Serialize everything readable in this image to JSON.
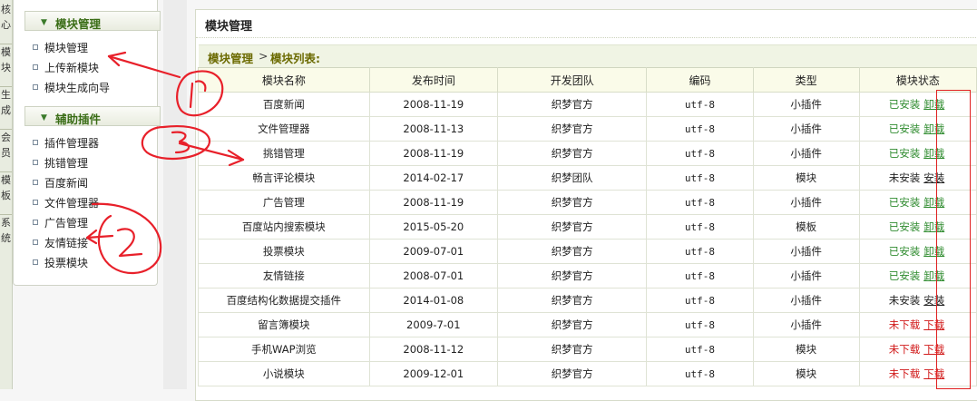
{
  "left_tabs": [
    "核心",
    "模块",
    "生成",
    "会员",
    "模板",
    "系统"
  ],
  "sidebar": {
    "groups": [
      {
        "title": "模块管理",
        "items": [
          "模块管理",
          "上传新模块",
          "模块生成向导"
        ]
      },
      {
        "title": "辅助插件",
        "items": [
          "插件管理器",
          "挑错管理",
          "百度新闻",
          "文件管理器",
          "广告管理",
          "友情链接",
          "投票模块"
        ]
      }
    ]
  },
  "main": {
    "title": "模块管理",
    "breadcrumb": {
      "part1": "模块管理",
      "sep": ">",
      "part2": "模块列表:"
    }
  },
  "table": {
    "headers": [
      "模块名称",
      "发布时间",
      "开发团队",
      "编码",
      "类型",
      "模块状态"
    ],
    "rows": [
      {
        "name": "百度新闻",
        "date": "2008-11-19",
        "team": "织梦官方",
        "enc": "utf-8",
        "type": "小插件",
        "status": "已安装",
        "action": "卸载",
        "color": "#2e8b2e"
      },
      {
        "name": "文件管理器",
        "date": "2008-11-13",
        "team": "织梦官方",
        "enc": "utf-8",
        "type": "小插件",
        "status": "已安装",
        "action": "卸载",
        "color": "#2e8b2e"
      },
      {
        "name": "挑错管理",
        "date": "2008-11-19",
        "team": "织梦官方",
        "enc": "utf-8",
        "type": "小插件",
        "status": "已安装",
        "action": "卸载",
        "color": "#2e8b2e"
      },
      {
        "name": "畅言评论模块",
        "date": "2014-02-17",
        "team": "织梦团队",
        "enc": "utf-8",
        "type": "模块",
        "status": "未安装",
        "action": "安装",
        "color": "#222222"
      },
      {
        "name": "广告管理",
        "date": "2008-11-19",
        "team": "织梦官方",
        "enc": "utf-8",
        "type": "小插件",
        "status": "已安装",
        "action": "卸载",
        "color": "#2e8b2e"
      },
      {
        "name": "百度站内搜索模块",
        "date": "2015-05-20",
        "team": "织梦官方",
        "enc": "utf-8",
        "type": "模板",
        "status": "已安装",
        "action": "卸载",
        "color": "#2e8b2e"
      },
      {
        "name": "投票模块",
        "date": "2009-07-01",
        "team": "织梦官方",
        "enc": "utf-8",
        "type": "小插件",
        "status": "已安装",
        "action": "卸载",
        "color": "#2e8b2e"
      },
      {
        "name": "友情链接",
        "date": "2008-07-01",
        "team": "织梦官方",
        "enc": "utf-8",
        "type": "小插件",
        "status": "已安装",
        "action": "卸载",
        "color": "#2e8b2e"
      },
      {
        "name": "百度结构化数据提交插件",
        "date": "2014-01-08",
        "team": "织梦官方",
        "enc": "utf-8",
        "type": "小插件",
        "status": "未安装",
        "action": "安装",
        "color": "#222222"
      },
      {
        "name": "留言簿模块",
        "date": "2009-7-01",
        "team": "织梦官方",
        "enc": "utf-8",
        "type": "小插件",
        "status": "未下载",
        "action": "下载",
        "color": "#d11a1a"
      },
      {
        "name": "手机WAP浏览",
        "date": "2008-11-12",
        "team": "织梦官方",
        "enc": "utf-8",
        "type": "模块",
        "status": "未下载",
        "action": "下载",
        "color": "#d11a1a"
      },
      {
        "name": "小说模块",
        "date": "2009-12-01",
        "team": "织梦官方",
        "enc": "utf-8",
        "type": "模块",
        "status": "未下载",
        "action": "下载",
        "color": "#d11a1a"
      }
    ]
  },
  "annotation_color": "#e8202a"
}
